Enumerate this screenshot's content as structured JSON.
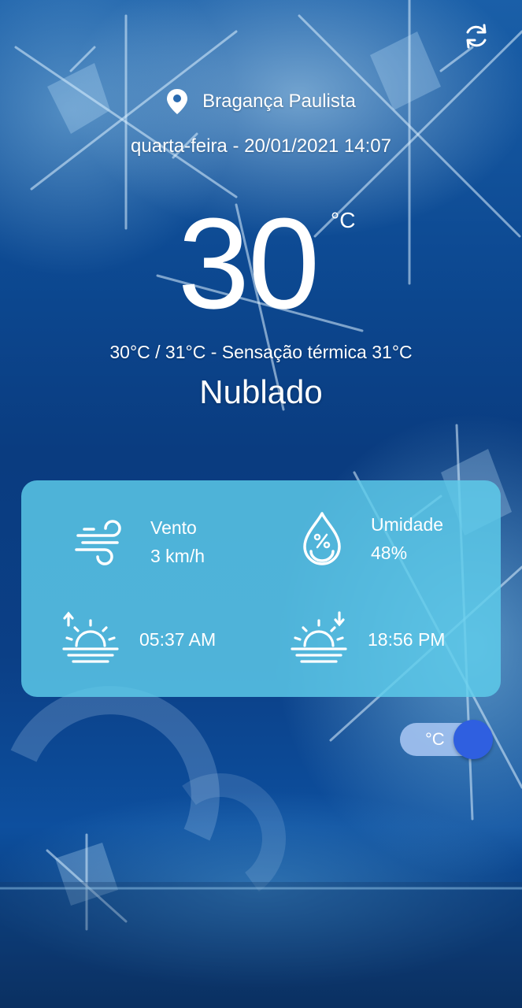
{
  "location": {
    "city": "Bragança Paulista",
    "icon": "map-pin-icon"
  },
  "datetime": "quarta-feira - 20/01/2021 14:07",
  "current": {
    "temperature": "30",
    "unit": "°C",
    "minmax_feels": "30°C / 31°C - Sensação térmica 31°C",
    "condition": "Nublado"
  },
  "details": {
    "wind": {
      "label": "Vento",
      "value": "3 km/h",
      "icon": "wind-icon"
    },
    "humidity": {
      "label": "Umidade",
      "value": "48%",
      "icon": "humidity-drop-icon"
    },
    "sunrise": {
      "time": "05:37 AM",
      "icon": "sunrise-icon"
    },
    "sunset": {
      "time": "18:56 PM",
      "icon": "sunset-icon"
    }
  },
  "toggle": {
    "label": "°C",
    "state": "on"
  },
  "actions": {
    "refresh_icon": "refresh-icon"
  },
  "colors": {
    "card": "#5ecdeb",
    "toggle_knob": "#2f5fe0",
    "toggle_track": "#aac8f5",
    "background": "#0d4a93"
  }
}
